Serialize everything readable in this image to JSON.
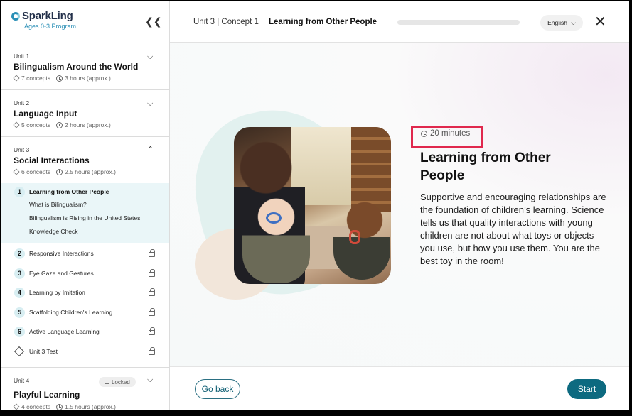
{
  "sidebar": {
    "brand_name": "SparkLing",
    "brand_sub": "Ages 0-3 Program",
    "collapse_icon": "double-chevron-left-icon",
    "units": [
      {
        "label": "Unit 1",
        "title": "Bilingualism Around the World",
        "concepts": "7 concepts",
        "hours": "3 hours (approx.)",
        "expanded": false
      },
      {
        "label": "Unit 2",
        "title": "Language Input",
        "concepts": "5 concepts",
        "hours": "2 hours (approx.)",
        "expanded": false
      },
      {
        "label": "Unit 3",
        "title": "Social Interactions",
        "concepts": "6 concepts",
        "hours": "2.5 hours (approx.)",
        "expanded": true
      },
      {
        "label": "Unit 4",
        "title": "Playful Learning",
        "concepts": "4 concepts",
        "hours": "1.5 hours (approx.)",
        "expanded": false,
        "badge": "Locked"
      }
    ],
    "unit3_concepts": [
      {
        "num": "1",
        "label": "Learning from Other People",
        "active": true,
        "subitems": [
          "What is Bilingualism?",
          "Bilingualism is Rising in the United States",
          "Knowledge Check"
        ]
      },
      {
        "num": "2",
        "label": "Responsive Interactions",
        "locked": true
      },
      {
        "num": "3",
        "label": "Eye Gaze and Gestures",
        "locked": true
      },
      {
        "num": "4",
        "label": "Learning by Imitation",
        "locked": true
      },
      {
        "num": "5",
        "label": "Scaffolding Children's Learning",
        "locked": true
      },
      {
        "num": "6",
        "label": "Active Language Learning",
        "locked": true
      },
      {
        "num": "",
        "label": "Unit 3 Test",
        "locked": true,
        "icon": "test-icon"
      }
    ]
  },
  "header": {
    "breadcrumb": "Unit 3 | Concept 1",
    "concept_title": "Learning from Other People",
    "progress": 0.0,
    "language": "English",
    "close_icon": "close-icon"
  },
  "main": {
    "duration": "20 minutes",
    "title": "Learning from Other People",
    "description": "Supportive and encouraging relationships are the foundation of children’s learning. Science tells us that quality interactions with young children are not about what toys or objects you use, but how you use them. You are the best toy in the room!",
    "highlight_color": "#e0284d"
  },
  "footer": {
    "back_label": "Go back",
    "start_label": "Start"
  },
  "colors": {
    "accent": "#0d6a80",
    "active_bg": "#eaf6f8"
  }
}
